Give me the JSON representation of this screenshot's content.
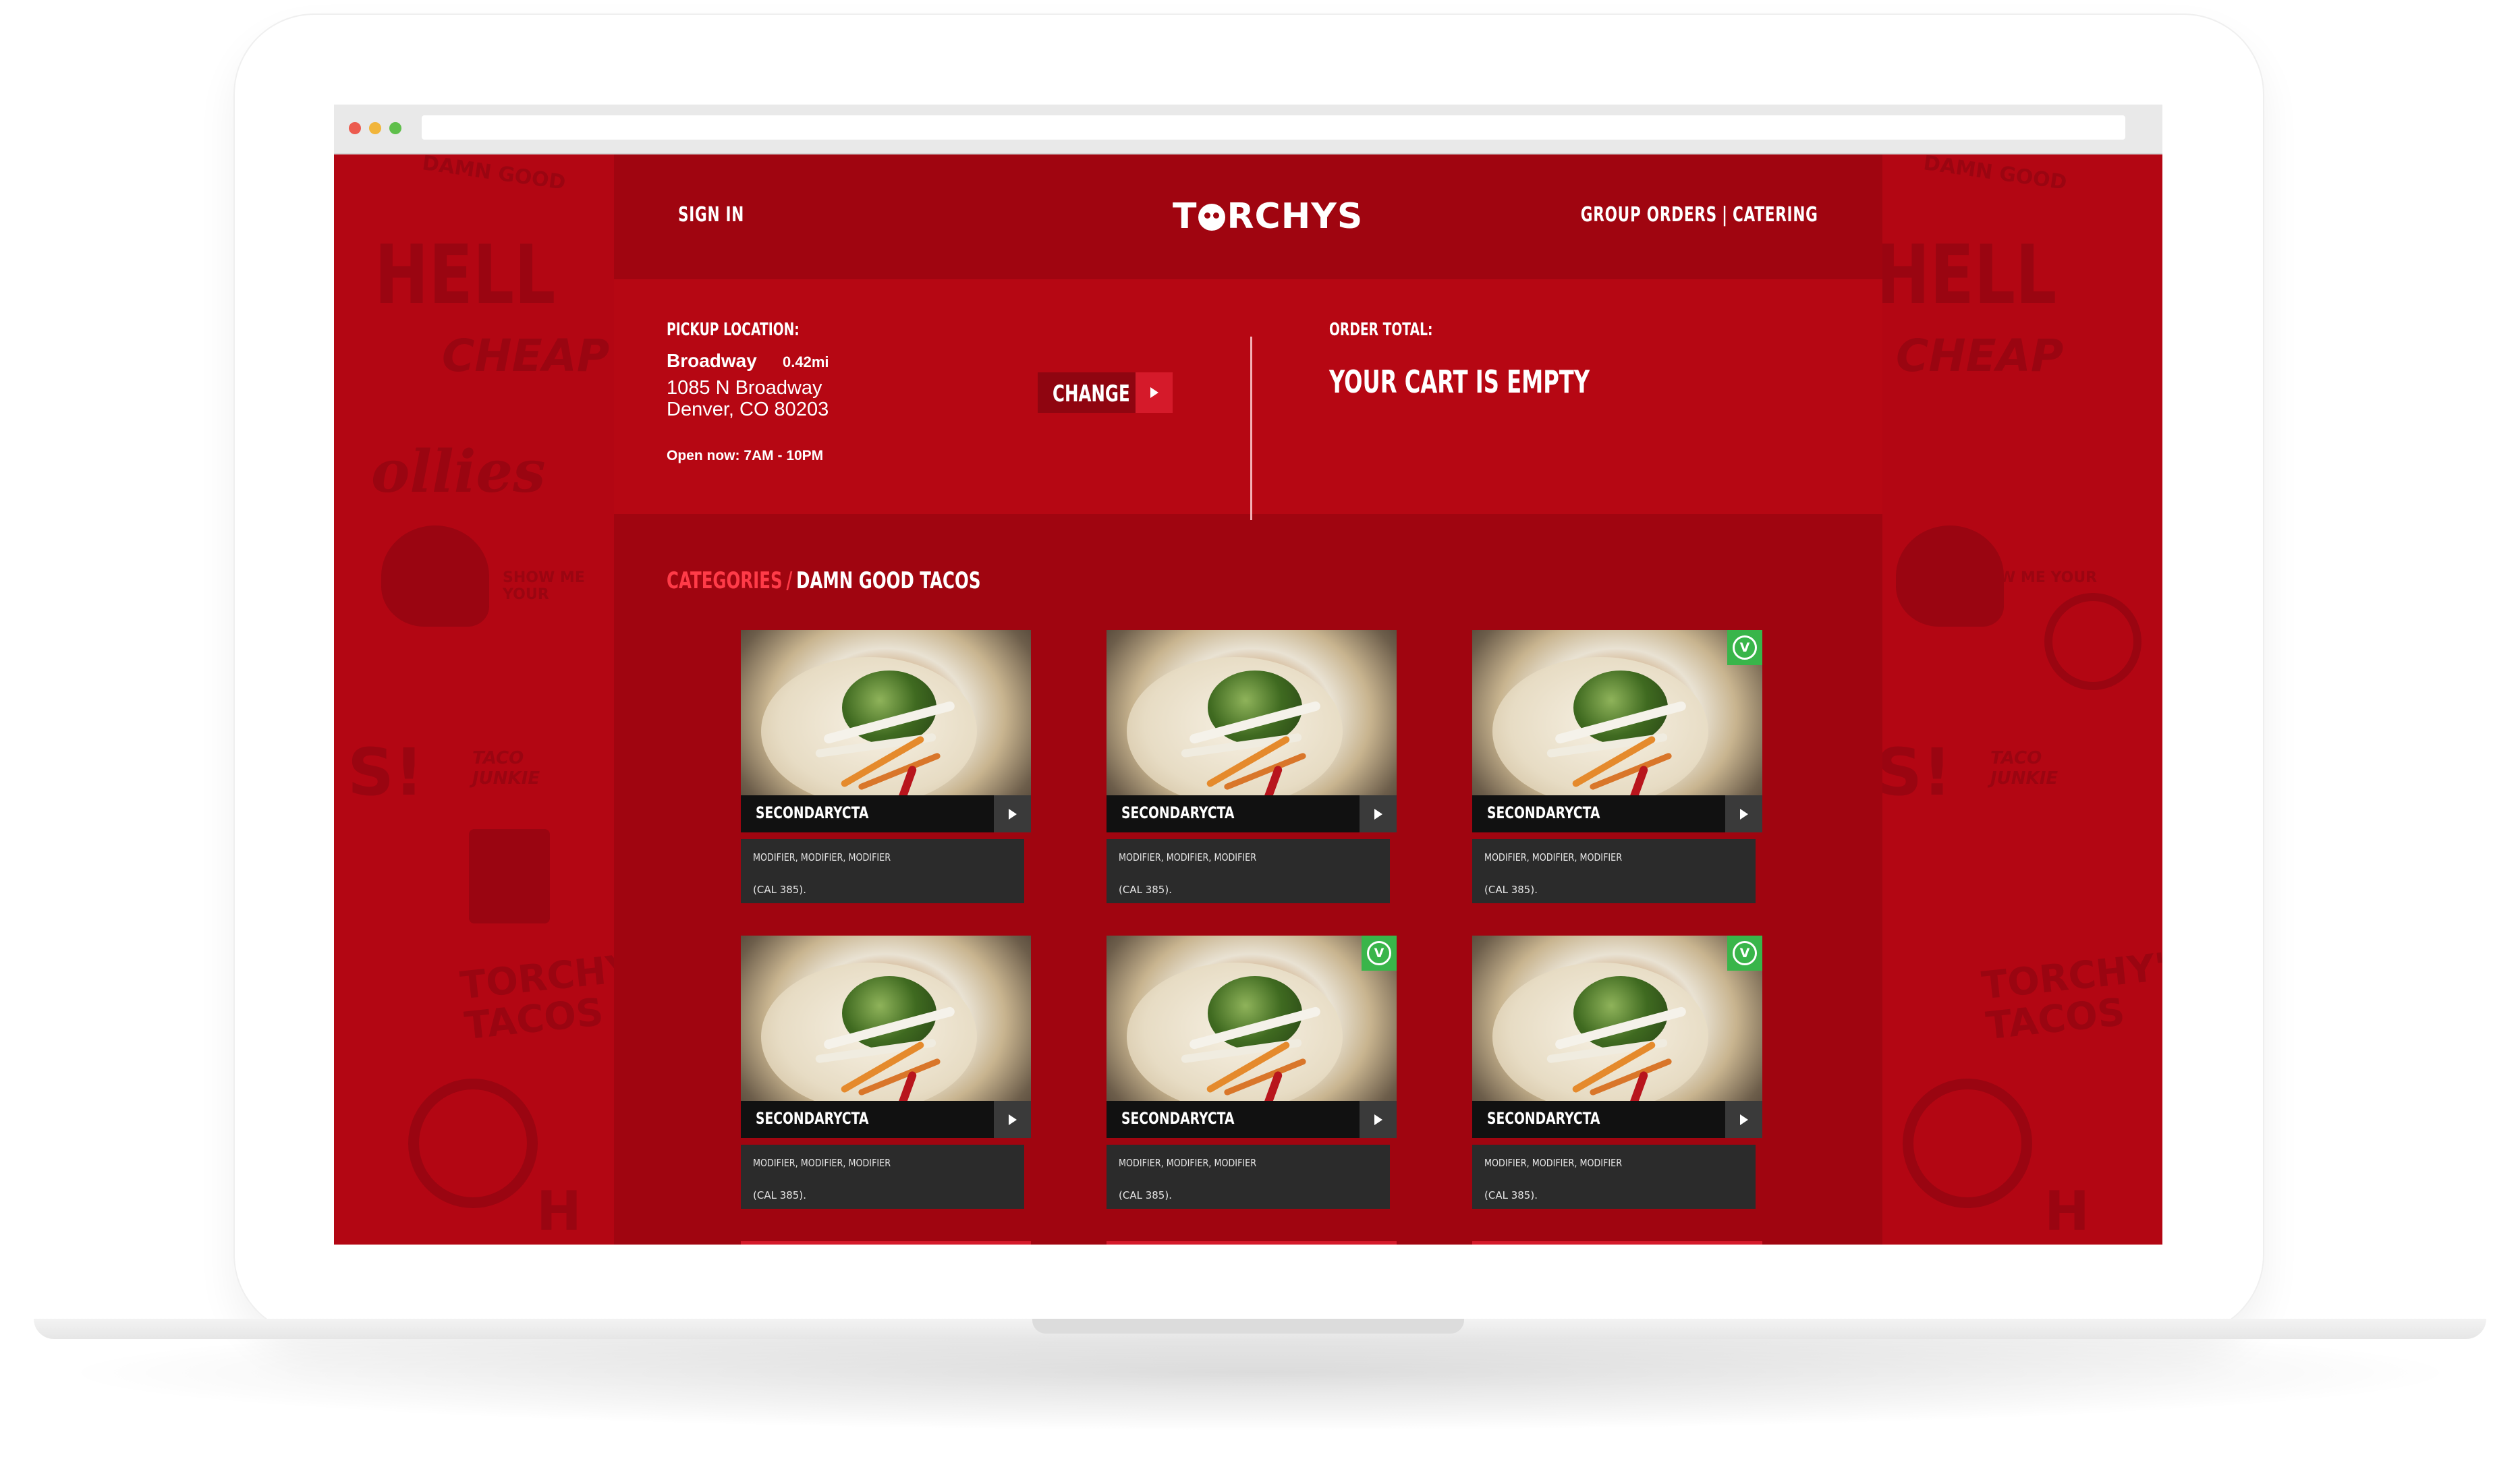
{
  "header": {
    "sign_in": "SIGN IN",
    "logo_text_1": "T",
    "logo_text_2": "RCHYS",
    "group_orders": "GROUP ORDERS",
    "link_separator": "|",
    "catering": "CATERING"
  },
  "pickup": {
    "label": "PICKUP LOCATION:",
    "name": "Broadway",
    "distance": "0.42mi",
    "address_line1": "1085 N Broadway",
    "address_line2": "Denver, CO 80203",
    "hours": "Open now: 7AM - 10PM",
    "change_label": "CHANGE"
  },
  "order": {
    "label": "ORDER TOTAL:",
    "status": "YOUR CART IS EMPTY"
  },
  "breadcrumb": {
    "parent": "CATEGORIES",
    "separator": "/",
    "current": "DAMN GOOD TACOS"
  },
  "products": [
    {
      "title": "secondaryCTA",
      "modifiers": "MODIFIER, MODIFIER, MODIFIER",
      "calories": "(CAL 385).",
      "vegetarian": false
    },
    {
      "title": "secondaryCTA",
      "modifiers": "MODIFIER, MODIFIER, MODIFIER",
      "calories": "(CAL 385).",
      "vegetarian": false
    },
    {
      "title": "secondaryCTA",
      "modifiers": "MODIFIER, MODIFIER, MODIFIER",
      "calories": "(CAL 385).",
      "vegetarian": true
    },
    {
      "title": "secondaryCTA",
      "modifiers": "MODIFIER, MODIFIER, MODIFIER",
      "calories": "(CAL 385).",
      "vegetarian": false
    },
    {
      "title": "secondaryCTA",
      "modifiers": "MODIFIER, MODIFIER, MODIFIER",
      "calories": "(CAL 385).",
      "vegetarian": true
    },
    {
      "title": "secondaryCTA",
      "modifiers": "MODIFIER, MODIFIER, MODIFIER",
      "calories": "(CAL 385).",
      "vegetarian": true
    }
  ],
  "veg_badge_letter": "V",
  "background_pattern": [
    "HELL",
    "CHEAP",
    "ollies",
    "SHOW ME YOUR",
    "S!",
    "TACO JUNKIE",
    "TORCHY'S TACOS",
    "DAMN GOOD",
    "H"
  ],
  "colors": {
    "brand_red": "#b30613",
    "header_dark_red": "#a00510",
    "accent_red": "#d51a2a",
    "veg_green": "#39b54a"
  },
  "icons": {
    "change": "play-arrow-icon",
    "card_action": "play-arrow-icon",
    "vegetarian": "vegetarian-badge-icon",
    "logo": "skull-logo-icon"
  }
}
